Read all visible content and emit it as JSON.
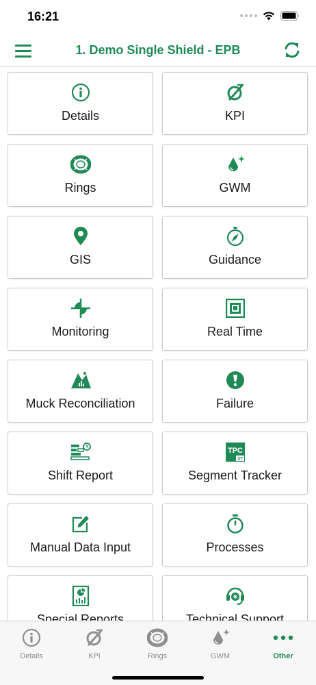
{
  "status": {
    "time": "16:21"
  },
  "header": {
    "title": "1. Demo Single Shield - EPB"
  },
  "colors": {
    "accent": "#1f8a56",
    "inactive": "#8e8e8e"
  },
  "tiles": [
    {
      "label": "Details",
      "icon": "info-icon"
    },
    {
      "label": "KPI",
      "icon": "kpi-icon"
    },
    {
      "label": "Rings",
      "icon": "rings-icon"
    },
    {
      "label": "GWM",
      "icon": "gwm-icon"
    },
    {
      "label": "GIS",
      "icon": "map-pin-icon"
    },
    {
      "label": "Guidance",
      "icon": "compass-icon"
    },
    {
      "label": "Monitoring",
      "icon": "crosshair-icon"
    },
    {
      "label": "Real Time",
      "icon": "realtime-icon"
    },
    {
      "label": "Muck Reconciliation",
      "icon": "muck-icon"
    },
    {
      "label": "Failure",
      "icon": "failure-icon"
    },
    {
      "label": "Shift Report",
      "icon": "shift-report-icon"
    },
    {
      "label": "Segment Tracker",
      "icon": "tpc-logo-icon"
    },
    {
      "label": "Manual Data Input",
      "icon": "edit-icon"
    },
    {
      "label": "Processes",
      "icon": "stopwatch-icon"
    },
    {
      "label": "Special Reports",
      "icon": "report-icon"
    },
    {
      "label": "Technical Support",
      "icon": "headset-icon"
    }
  ],
  "tabs": [
    {
      "label": "Details",
      "icon": "info-icon",
      "active": false
    },
    {
      "label": "KPI",
      "icon": "kpi-icon",
      "active": false
    },
    {
      "label": "Rings",
      "icon": "rings-icon",
      "active": false
    },
    {
      "label": "GWM",
      "icon": "gwm-icon",
      "active": false
    },
    {
      "label": "Other",
      "icon": "more-icon",
      "active": true
    }
  ],
  "tpc_logo": {
    "main": "TPC",
    "sub": "ST"
  }
}
